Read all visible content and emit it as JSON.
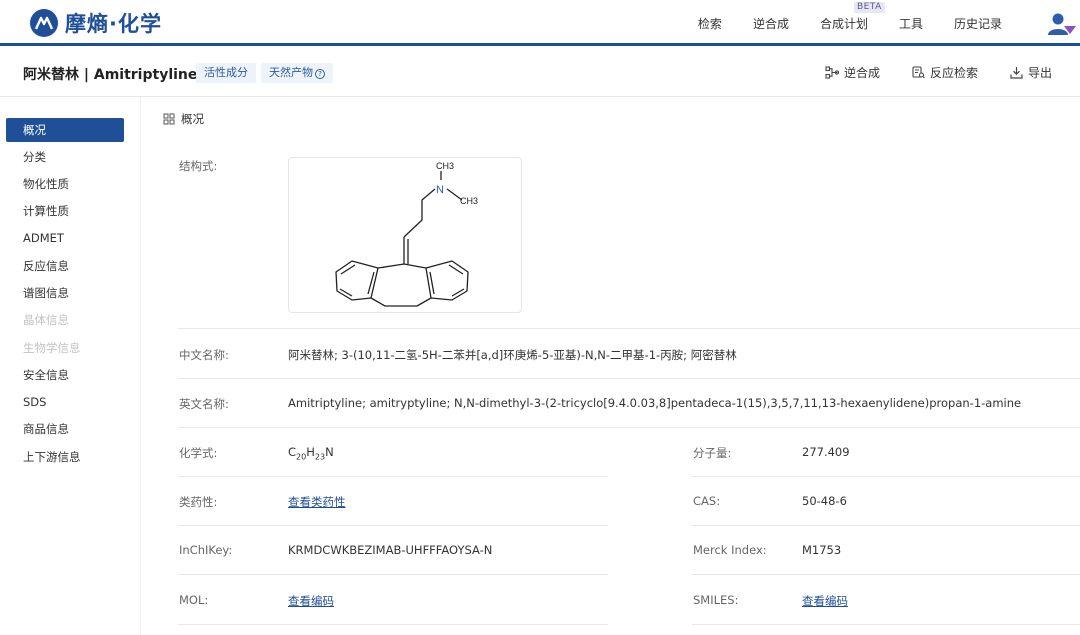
{
  "brand": {
    "name": "摩熵·化学"
  },
  "nav": [
    {
      "label": "检索"
    },
    {
      "label": "逆合成"
    },
    {
      "label": "合成计划",
      "badge": "BETA"
    },
    {
      "label": "工具"
    },
    {
      "label": "历史记录"
    }
  ],
  "title": "阿米替林 | Amitriptyline",
  "tags": [
    {
      "label": "活性成分"
    },
    {
      "label": "天然产物"
    }
  ],
  "actions": [
    {
      "label": "逆合成",
      "icon": "retrosynthesis-icon"
    },
    {
      "label": "反应检索",
      "icon": "reaction-search-icon"
    },
    {
      "label": "导出",
      "icon": "download-icon"
    }
  ],
  "sidebar": [
    {
      "label": "概况",
      "state": "active"
    },
    {
      "label": "分类",
      "state": "normal"
    },
    {
      "label": "物化性质",
      "state": "normal"
    },
    {
      "label": "计算性质",
      "state": "normal"
    },
    {
      "label": "ADMET",
      "state": "normal"
    },
    {
      "label": "反应信息",
      "state": "normal"
    },
    {
      "label": "谱图信息",
      "state": "normal"
    },
    {
      "label": "晶体信息",
      "state": "disabled"
    },
    {
      "label": "生物学信息",
      "state": "disabled"
    },
    {
      "label": "安全信息",
      "state": "normal"
    },
    {
      "label": "SDS",
      "state": "normal"
    },
    {
      "label": "商品信息",
      "state": "normal"
    },
    {
      "label": "上下游信息",
      "state": "normal"
    }
  ],
  "overview": {
    "heading": "概况",
    "structure_label": "结构式:",
    "structure_atoms": {
      "n": "N",
      "ch3_top": "CH3",
      "ch3_right": "CH3"
    },
    "cn_name_label": "中文名称:",
    "cn_name": "阿米替林; 3-(10,11-二氢-5H-二苯并[a,d]环庚烯-5-亚基)-N,N-二甲基-1-丙胺; 阿密替林",
    "en_name_label": "英文名称:",
    "en_name": "Amitriptyline; amitryptyline; N,N-dimethyl-3-(2-tricyclo[9.4.0.03,8]pentadeca-1(15),3,5,7,11,13-hexaenylidene)propan-1-amine",
    "formula_label": "化学式:",
    "formula": {
      "c": "C",
      "c_n": "20",
      "h": "H",
      "h_n": "23",
      "n": "N"
    },
    "mw_label": "分子量:",
    "mw": "277.409",
    "druglike_label": "类药性:",
    "druglike_link": "查看类药性",
    "cas_label": "CAS:",
    "cas": "50-48-6",
    "inchikey_label": "InChIKey:",
    "inchikey": "KRMDCWKBEZIMAB-UHFFFAOYSA-N",
    "merck_label": "Merck Index:",
    "merck": "M1753",
    "mol_label": "MOL:",
    "mol_link": "查看编码",
    "smiles_label": "SMILES:",
    "smiles_link": "查看编码"
  },
  "colors": {
    "brand": "#1f4f96",
    "tag_bg": "#eef3fa",
    "disabled": "#c3c3c3"
  }
}
